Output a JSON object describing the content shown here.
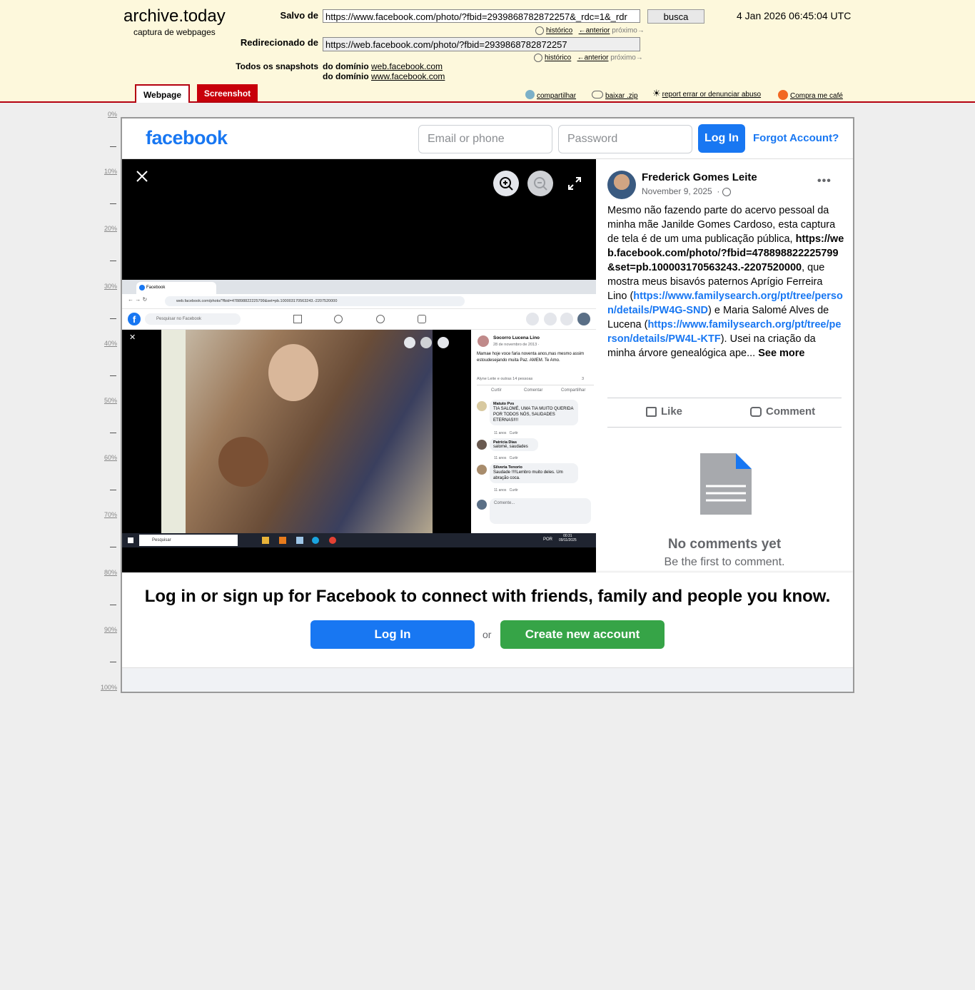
{
  "archive": {
    "logo": "archive.today",
    "tagline": "captura de webpages",
    "saved_label": "Salvo de",
    "saved_url": "https://www.facebook.com/photo/?fbid=2939868782872257&_rdc=1&_rdr",
    "search_button": "busca",
    "date": "4 Jan 2026 06:45:04 UTC",
    "history": "histórico",
    "prev": "←anterior",
    "next": "próximo→",
    "redirect_label": "Redirecionado de",
    "redirect_url": "https://web.facebook.com/photo/?fbid=2939868782872257",
    "snapshots_label": "Todos os snapshots",
    "domain_prefix": "do domínio",
    "domain1": "web.facebook.com",
    "domain2": "www.facebook.com",
    "tab_webpage": "Webpage",
    "tab_screenshot": "Screenshot",
    "share": "compartilhar",
    "download": "baixar .zip",
    "report": "report errar or denunciar abuso",
    "coffee": "Compra me café"
  },
  "ruler": [
    "0%",
    "10%",
    "20%",
    "30%",
    "40%",
    "50%",
    "60%",
    "70%",
    "80%",
    "90%",
    "100%"
  ],
  "facebook": {
    "logo": "facebook",
    "email_placeholder": "Email or phone",
    "password_placeholder": "Password",
    "login": "Log In",
    "forgot": "Forgot Account?",
    "post": {
      "author": "Frederick Gomes Leite",
      "date": "November 9, 2025",
      "text_1": "Mesmo não fazendo parte do acervo pessoal da minha mãe Janilde Gomes Cardoso, esta captura de tela é de um uma publicação pública,",
      "link_1": "https://web.facebook.com/photo/?fbid=478898822225799&set=pb.100003170563243.-2207520000",
      "text_2": ", que mostra meus bisavós paternos Aprígio Ferreira Lino (",
      "link_2": "https://www.familysearch.org/pt/tree/person/details/PW4G-SND",
      "text_3": ") e Maria Salomé Alves de Lucena (",
      "link_3": "https://www.familysearch.org/pt/tree/person/details/PW4L-KTF",
      "text_4": "). Usei na criação da minha árvore genealógica ape...",
      "see_more": "See more",
      "like": "Like",
      "comment": "Comment",
      "no_comments": "No comments yet",
      "be_first": "Be the first to comment."
    },
    "cta_title": "Log in or sign up for Facebook to connect with friends, family and people you know.",
    "cta_login": "Log In",
    "cta_or": "or",
    "cta_create": "Create new account"
  },
  "screenshot": {
    "tab_title": "Facebook",
    "url": "web.facebook.com/photo/?fbid=478898822225799&set=pb.100003170563243.-2207520000",
    "search_placeholder": "Pesquisar no Facebook",
    "author": "Socorro Lucena Lino",
    "date": "28 de novembro de 2013 ·",
    "text": "Mamae hoje voce faria noventa anos,mas mesmo assim estoudesejando muita Paz. AMEM. Te Amo.",
    "reactions": "Alyne Leite e outras 14 pessoas",
    "reaction_count": "3",
    "like": "Curtir",
    "comment": "Comentar",
    "share": "Compartilhar",
    "comments": [
      {
        "name": "Matuto Pvs",
        "text": "TIA SALOMÉ, UMA TIA MUITO QUERIDA POR TODOS NÓS, SAUDADES ETERNAS!!!!",
        "time": "11 anos",
        "action": "Curtir"
      },
      {
        "name": "Patrícia Dias",
        "text": "salomé, saudades",
        "time": "11 anos",
        "action": "Curtir"
      },
      {
        "name": "Silveria Tenorio",
        "text": "Saudade !!!!Lembro muito deles. Um abração coca.",
        "time": "11 anos",
        "action": "Curtir"
      }
    ],
    "comment_placeholder": "Comente...",
    "taskbar_search": "Pesquisar",
    "taskbar_lang": "POR",
    "taskbar_time": "00:31",
    "taskbar_date": "09/11/2025"
  },
  "colors": {
    "archive_bg": "#fdf8dc",
    "archive_red": "#b40010",
    "fb_blue": "#1877f2",
    "fb_green": "#42b72a"
  }
}
